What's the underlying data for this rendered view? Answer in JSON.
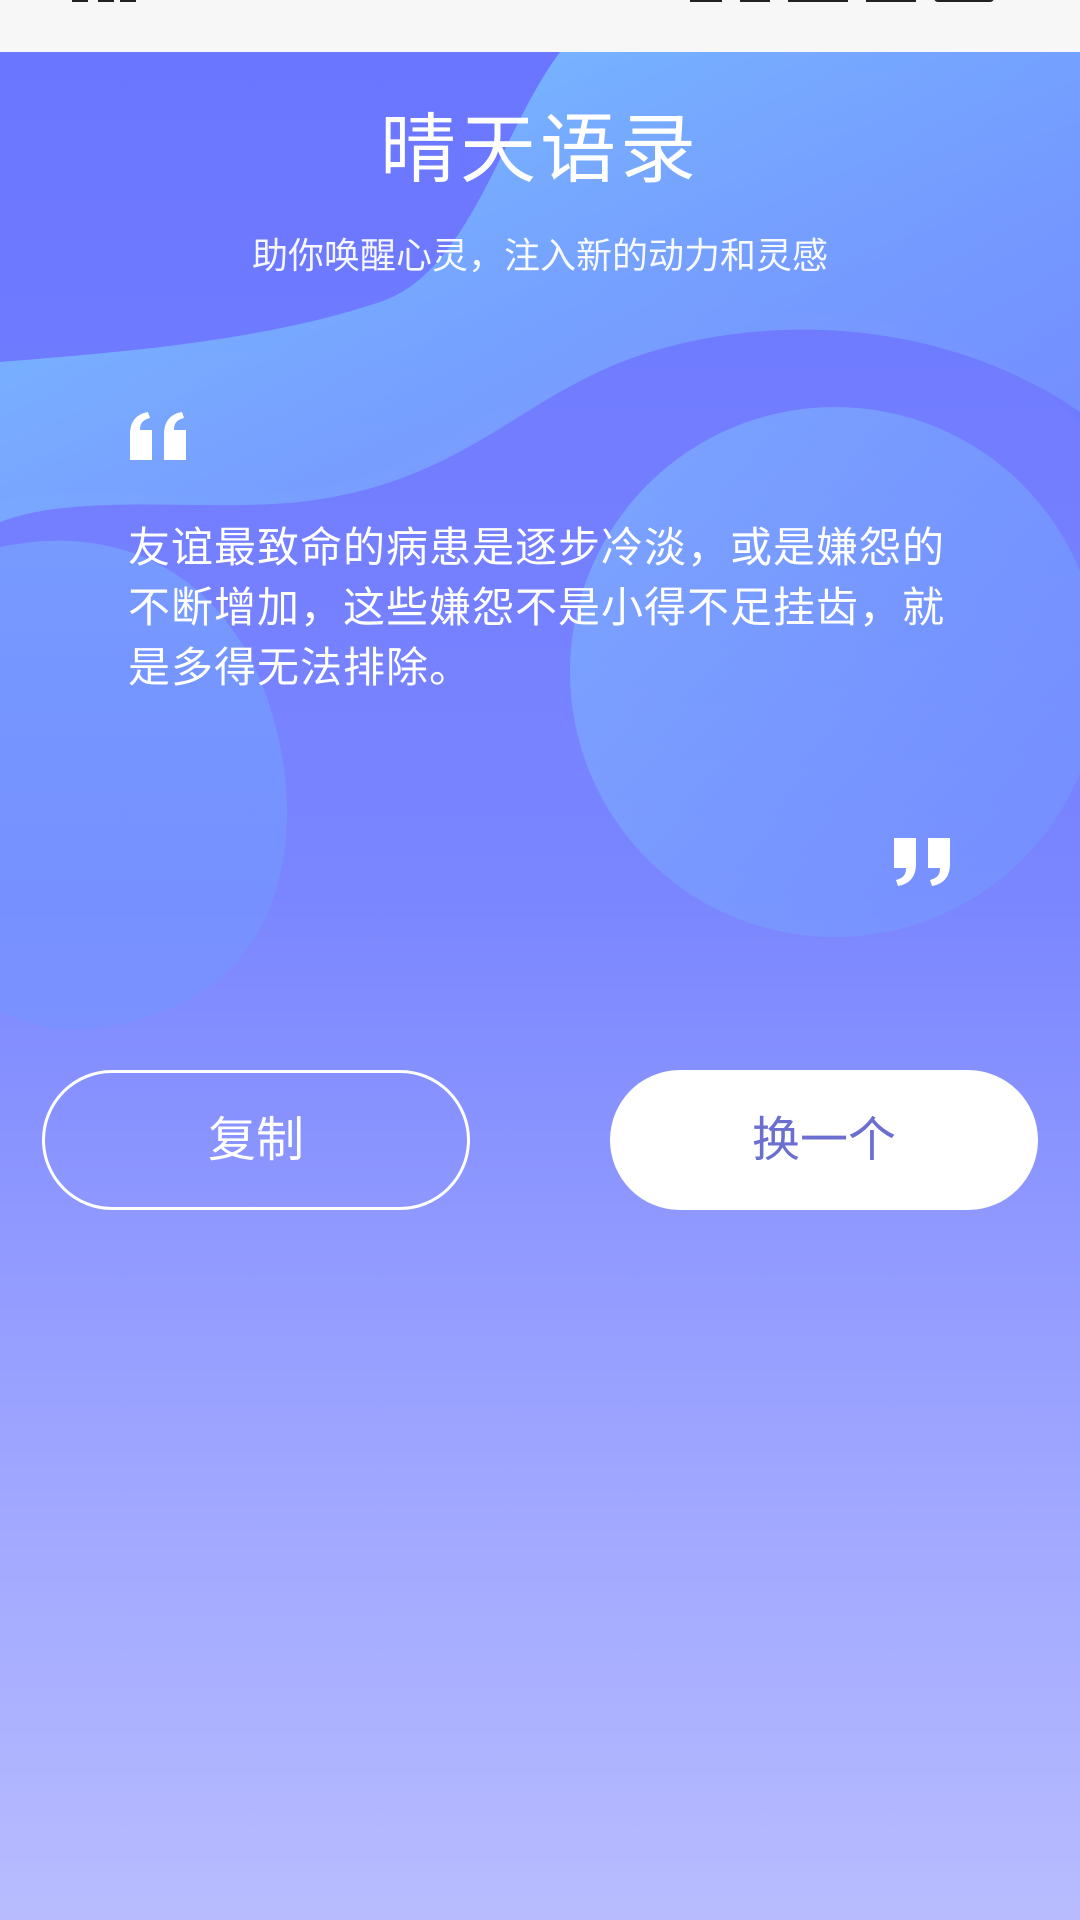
{
  "header": {
    "title": "晴天语录",
    "subtitle": "助你唤醒心灵，注入新的动力和灵感"
  },
  "quote": {
    "text": "友谊最致命的病患是逐步冷淡，或是嫌怨的不断增加，这些嫌怨不是小得不足挂齿，就是多得无法排除。"
  },
  "actions": {
    "copy_label": "复制",
    "change_label": "换一个"
  },
  "colors": {
    "background_top": "#6b76ff",
    "background_bottom": "#b8bcff",
    "accent_text": "#6a6fd0"
  },
  "icons": {
    "open_quote": "open-quote-icon",
    "close_quote": "close-quote-icon"
  }
}
